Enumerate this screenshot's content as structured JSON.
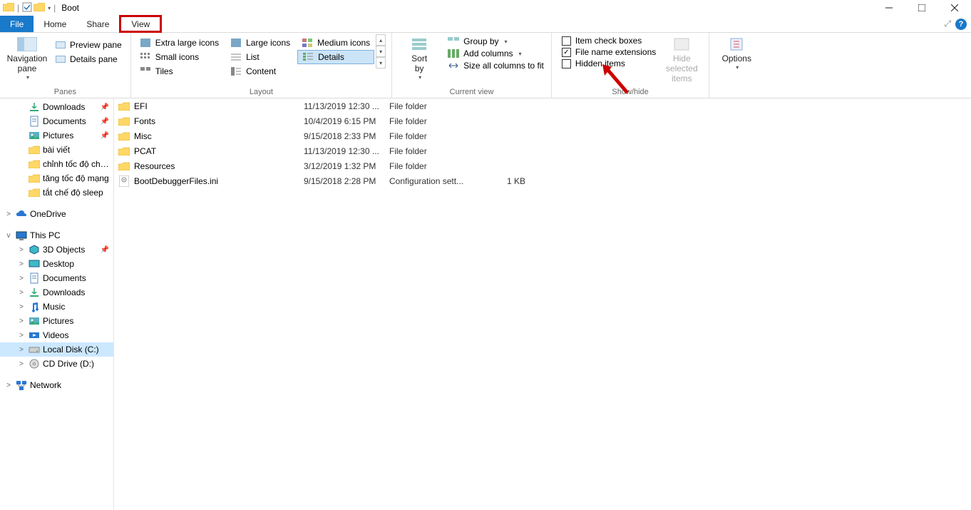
{
  "window": {
    "title": "Boot"
  },
  "tabs": {
    "file": "File",
    "home": "Home",
    "share": "Share",
    "view": "View"
  },
  "ribbon": {
    "panes": {
      "nav": "Navigation\npane",
      "preview": "Preview pane",
      "details": "Details pane",
      "group": "Panes"
    },
    "layout": {
      "xl": "Extra large icons",
      "lg": "Large icons",
      "md": "Medium icons",
      "sm": "Small icons",
      "list": "List",
      "details": "Details",
      "tiles": "Tiles",
      "content": "Content",
      "group": "Layout"
    },
    "curview": {
      "sort": "Sort\nby",
      "group_by": "Group by",
      "add_cols": "Add columns",
      "size_cols": "Size all columns to fit",
      "group": "Current view"
    },
    "showhide": {
      "item_chk": "Item check boxes",
      "ext": "File name extensions",
      "hidden": "Hidden items",
      "hide_sel": "Hide selected\nitems",
      "group": "Show/hide"
    },
    "options": "Options"
  },
  "nav": [
    {
      "indent": 1,
      "icon": "download",
      "label": "Downloads",
      "pin": true
    },
    {
      "indent": 1,
      "icon": "doc",
      "label": "Documents",
      "pin": true
    },
    {
      "indent": 1,
      "icon": "pic",
      "label": "Pictures",
      "pin": true
    },
    {
      "indent": 1,
      "icon": "folder",
      "label": "bài viết"
    },
    {
      "indent": 1,
      "icon": "folder",
      "label": "chỉnh tốc độ chuột"
    },
    {
      "indent": 1,
      "icon": "folder",
      "label": "tăng tốc độ mạng"
    },
    {
      "indent": 1,
      "icon": "folder",
      "label": "tắt chế độ sleep"
    },
    {
      "spacer": true
    },
    {
      "indent": 0,
      "exp": ">",
      "icon": "onedrive",
      "label": "OneDrive"
    },
    {
      "spacer": true
    },
    {
      "indent": 0,
      "exp": "v",
      "icon": "pc",
      "label": "This PC"
    },
    {
      "indent": 1,
      "exp": ">",
      "icon": "3d",
      "label": "3D Objects",
      "pin": true
    },
    {
      "indent": 1,
      "exp": ">",
      "icon": "desktop",
      "label": "Desktop"
    },
    {
      "indent": 1,
      "exp": ">",
      "icon": "doc",
      "label": "Documents"
    },
    {
      "indent": 1,
      "exp": ">",
      "icon": "download",
      "label": "Downloads"
    },
    {
      "indent": 1,
      "exp": ">",
      "icon": "music",
      "label": "Music"
    },
    {
      "indent": 1,
      "exp": ">",
      "icon": "pic",
      "label": "Pictures"
    },
    {
      "indent": 1,
      "exp": ">",
      "icon": "video",
      "label": "Videos"
    },
    {
      "indent": 1,
      "exp": ">",
      "icon": "disk",
      "label": "Local Disk (C:)",
      "selected": true
    },
    {
      "indent": 1,
      "exp": ">",
      "icon": "cd",
      "label": "CD Drive (D:)"
    },
    {
      "spacer": true
    },
    {
      "indent": 0,
      "exp": ">",
      "icon": "network",
      "label": "Network"
    }
  ],
  "files": [
    {
      "icon": "folder",
      "name": "EFI",
      "date": "11/13/2019 12:30 ...",
      "type": "File folder",
      "size": ""
    },
    {
      "icon": "folder",
      "name": "Fonts",
      "date": "10/4/2019 6:15 PM",
      "type": "File folder",
      "size": ""
    },
    {
      "icon": "folder",
      "name": "Misc",
      "date": "9/15/2018 2:33 PM",
      "type": "File folder",
      "size": ""
    },
    {
      "icon": "folder",
      "name": "PCAT",
      "date": "11/13/2019 12:30 ...",
      "type": "File folder",
      "size": ""
    },
    {
      "icon": "folder",
      "name": "Resources",
      "date": "3/12/2019 1:32 PM",
      "type": "File folder",
      "size": ""
    },
    {
      "icon": "ini",
      "name": "BootDebuggerFiles.ini",
      "date": "9/15/2018 2:28 PM",
      "type": "Configuration sett...",
      "size": "1 KB"
    }
  ]
}
